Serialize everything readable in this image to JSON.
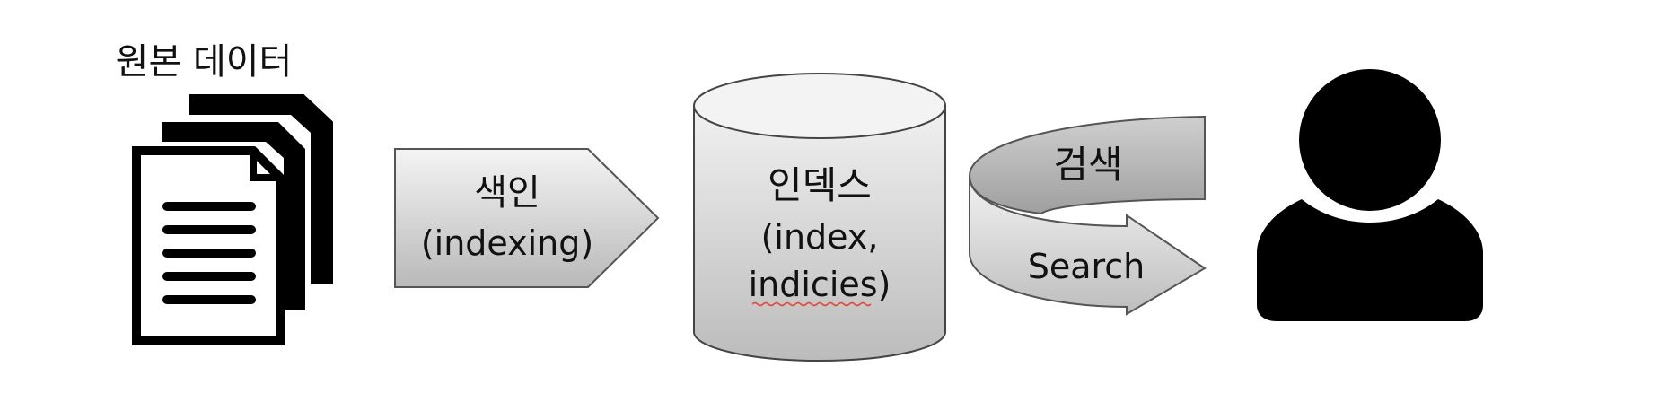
{
  "source": {
    "title": "원본 데이터"
  },
  "indexing": {
    "label_ko": "색인",
    "label_en": "(indexing)"
  },
  "index_store": {
    "label_ko": "인덱스",
    "label_en_line1": "(index,",
    "label_en_line2": "indicies)"
  },
  "search": {
    "label_ko": "검색",
    "label_en": "Search"
  },
  "colors": {
    "ink": "#000000",
    "gray_light": "#f2f2f2",
    "gray_dark": "#bdbdbd",
    "spellcheck_underline": "#e24a3b"
  },
  "icons": [
    "document-stack-icon",
    "database-cylinder-icon",
    "user-icon"
  ]
}
